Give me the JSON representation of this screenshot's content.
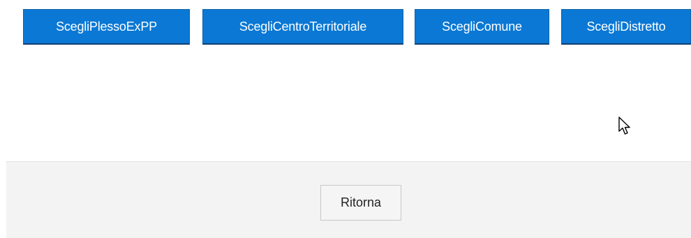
{
  "top_buttons": [
    {
      "label": "ScegliPlessoExPP"
    },
    {
      "label": "ScegliCentroTerritoriale"
    },
    {
      "label": "ScegliComune"
    },
    {
      "label": "ScegliDistretto"
    }
  ],
  "footer": {
    "return_label": "Ritorna"
  },
  "cursor": {
    "icon": "mouse-pointer-icon"
  },
  "colors": {
    "primary_button": "#0a78d4",
    "footer_bg": "#f3f3f3"
  }
}
